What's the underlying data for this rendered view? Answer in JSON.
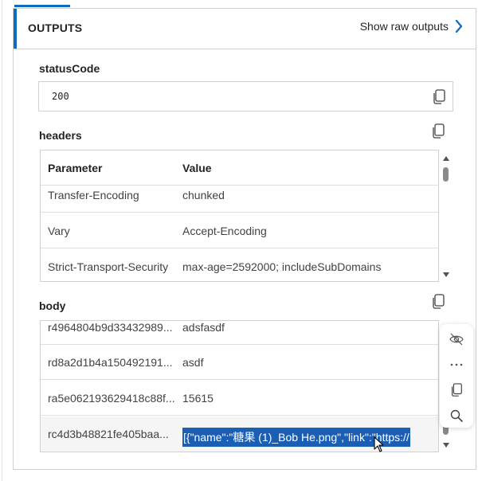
{
  "header": {
    "title": "OUTPUTS",
    "raw_link": "Show raw outputs"
  },
  "status_code": {
    "label": "statusCode",
    "value": "200"
  },
  "headers_section": {
    "label": "headers",
    "columns": [
      "Parameter",
      "Value"
    ],
    "rows": [
      [
        "Transfer-Encoding",
        "chunked"
      ],
      [
        "Vary",
        "Accept-Encoding"
      ],
      [
        "Strict-Transport-Security",
        "max-age=2592000; includeSubDomains"
      ]
    ]
  },
  "body_section": {
    "label": "body",
    "rows": [
      [
        "r4964804b9d33432989...",
        "adsfasdf"
      ],
      [
        "rd8a2d1b4a150492191...",
        "asdf"
      ],
      [
        "ra5e062193629418c88f...",
        "15615"
      ],
      [
        "rc4d3b48821fe405baa...",
        "[{\"name\":\"糖果 (1)_Bob He.png\",\"link\":\"https://..."
      ]
    ]
  },
  "icons": {
    "raw_link": "chevron-right-icon",
    "copy": "copy-icon",
    "hide": "eye-off-icon",
    "more": "more-horizontal-icon",
    "search": "search-icon"
  },
  "colors": {
    "accent": "#0f6cbd",
    "selection": "#1a5fb4"
  }
}
